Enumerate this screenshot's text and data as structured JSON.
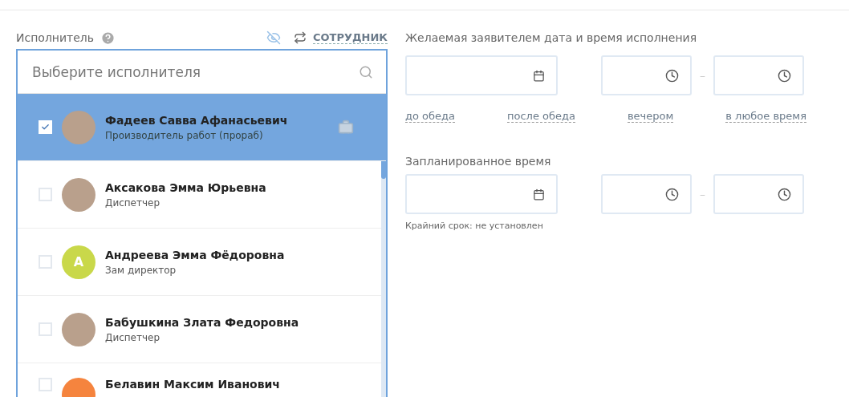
{
  "assignee": {
    "label": "Исполнитель",
    "mode_link": "СОТРУДНИК",
    "search": {
      "placeholder": "Выберите исполнителя"
    },
    "items": [
      {
        "name": "Фадеев Савва Афанасьевич",
        "role": "Производитель работ (прораб)",
        "selected": true,
        "checked": true,
        "kind": "photo"
      },
      {
        "name": "Аксакова Эмма Юрьевна",
        "role": "Диспетчер",
        "selected": false,
        "checked": false,
        "kind": "photo"
      },
      {
        "name": "Андреева Эмма Фёдоровна",
        "role": "Зам директор",
        "selected": false,
        "checked": false,
        "kind": "initial",
        "initial": "А",
        "color": "#c9d84a"
      },
      {
        "name": "Бабушкина Злата Федоровна",
        "role": "Диспетчер",
        "selected": false,
        "checked": false,
        "kind": "photo"
      },
      {
        "name": "Белавин Максим Иванович",
        "selected": false,
        "checked": false,
        "kind": "initial",
        "color": "#f5843e"
      }
    ]
  },
  "desired": {
    "label": "Желаемая заявителем дата и время исполнения",
    "separator": "–",
    "presets": [
      "до обеда",
      "после обеда",
      "вечером",
      "в любое время"
    ]
  },
  "planned": {
    "label": "Запланированное время",
    "separator": "–",
    "deadline": "Крайний срок: не установлен"
  }
}
